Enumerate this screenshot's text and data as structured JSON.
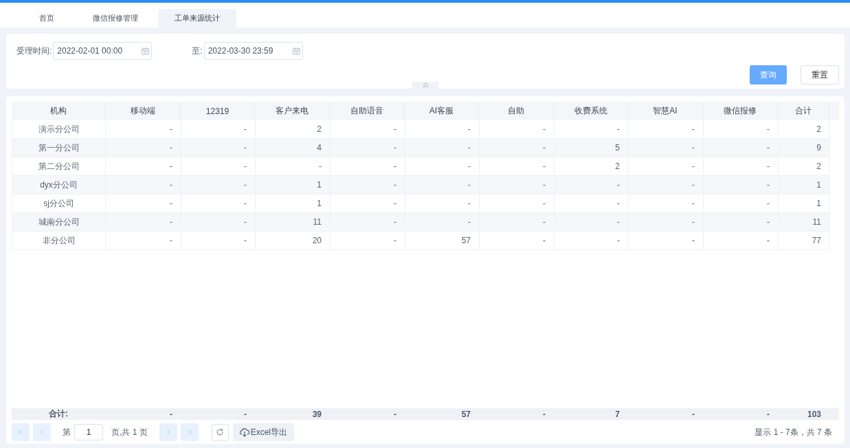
{
  "tabs": [
    {
      "label": "首页",
      "selected": false
    },
    {
      "label": "微信报修管理",
      "selected": false
    },
    {
      "label": "工单来源统计",
      "selected": true
    }
  ],
  "filters": [
    {
      "label": "受理时间:",
      "value": "2022-02-01 00:00"
    },
    {
      "label": "至:",
      "value": "2022-03-30 23:59"
    }
  ],
  "buttons": [
    {
      "label": "查询",
      "kind": "primary"
    },
    {
      "label": "重置",
      "kind": "default"
    }
  ],
  "table": {
    "columns": [
      "机构",
      "移动端",
      "12319",
      "客户来电",
      "自助语音",
      "AI客服",
      "自助",
      "收费系统",
      "智慧AI",
      "微信报修",
      "合计"
    ],
    "rows": [
      [
        "演示分公司",
        "-",
        "-",
        "2",
        "-",
        "-",
        "-",
        "-",
        "-",
        "-",
        "2"
      ],
      [
        "第一分公司",
        "-",
        "-",
        "4",
        "-",
        "-",
        "-",
        "5",
        "-",
        "-",
        "9"
      ],
      [
        "第二分公司",
        "-",
        "-",
        "-",
        "-",
        "-",
        "-",
        "2",
        "-",
        "-",
        "2"
      ],
      [
        "dyx分公司",
        "-",
        "-",
        "1",
        "-",
        "-",
        "-",
        "-",
        "-",
        "-",
        "1"
      ],
      [
        "sj分公司",
        "-",
        "-",
        "1",
        "-",
        "-",
        "-",
        "-",
        "-",
        "-",
        "1"
      ],
      [
        "城南分公司",
        "-",
        "-",
        "11",
        "-",
        "-",
        "-",
        "-",
        "-",
        "-",
        "11"
      ],
      [
        "非分公司",
        "-",
        "-",
        "20",
        "-",
        "57",
        "-",
        "-",
        "-",
        "-",
        "77"
      ]
    ],
    "totals": [
      "合计:",
      "-",
      "-",
      "39",
      "-",
      "57",
      "-",
      "7",
      "-",
      "-",
      "103"
    ]
  },
  "pager": {
    "first": {
      "disabled": true
    },
    "prev": {
      "disabled": true
    },
    "page_prefix": "第",
    "page_value": "1",
    "page_suffix": "页,共 1 页",
    "next": {
      "disabled": true
    },
    "last": {
      "disabled": true
    },
    "export": "Excel导出",
    "summary": "显示 1 - 7条，共 7 条"
  }
}
